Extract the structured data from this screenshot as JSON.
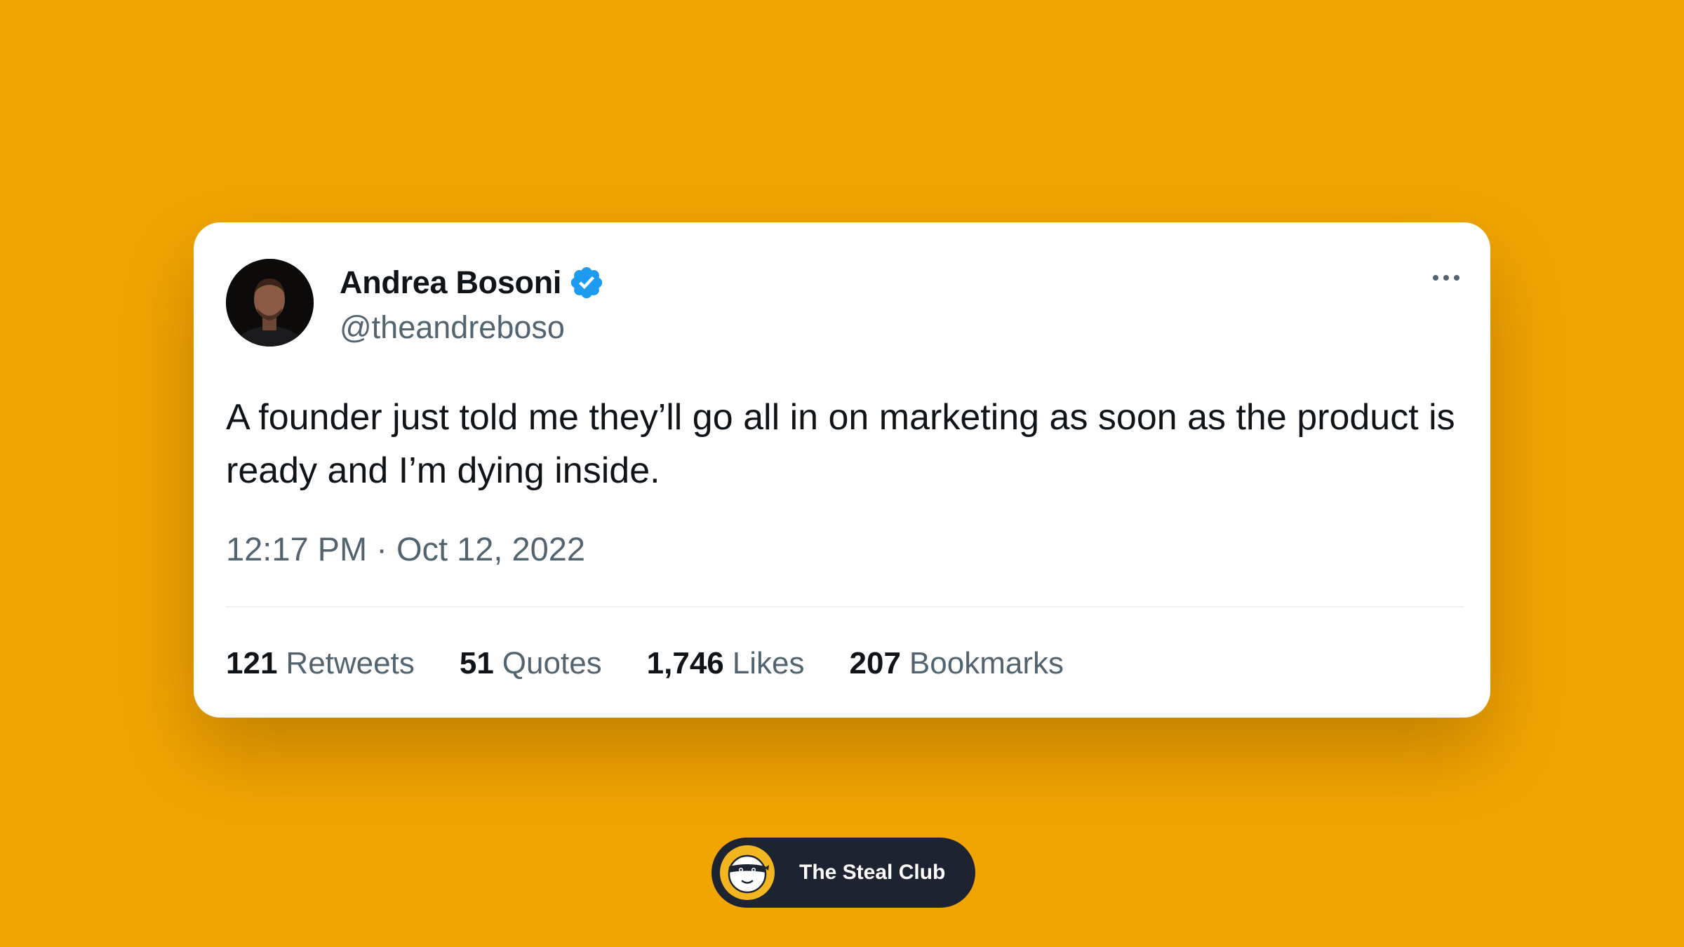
{
  "colors": {
    "background": "#F0A500",
    "card": "#FFFFFF",
    "text_primary": "#0F1419",
    "text_secondary": "#536471",
    "verified_blue": "#1D9BF0",
    "pill_background": "#1D2330",
    "pill_logo": "#F2B620"
  },
  "tweet": {
    "author_name": "Andrea Bosoni",
    "handle": "@theandreboso",
    "verified": true,
    "text": "A founder just told me they’ll go all in on marketing as soon as the product is ready and I’m dying inside.",
    "timestamp": "12:17 PM · Oct 12, 2022",
    "stats": [
      {
        "count": "121",
        "label": "Retweets"
      },
      {
        "count": "51",
        "label": "Quotes"
      },
      {
        "count": "1,746",
        "label": "Likes"
      },
      {
        "count": "207",
        "label": "Bookmarks"
      }
    ]
  },
  "icons": {
    "verified": "verified-badge-icon",
    "more": "more-options-icon",
    "brand": "bandit-mask-icon"
  },
  "footer": {
    "brand_name": "The Steal Club"
  }
}
